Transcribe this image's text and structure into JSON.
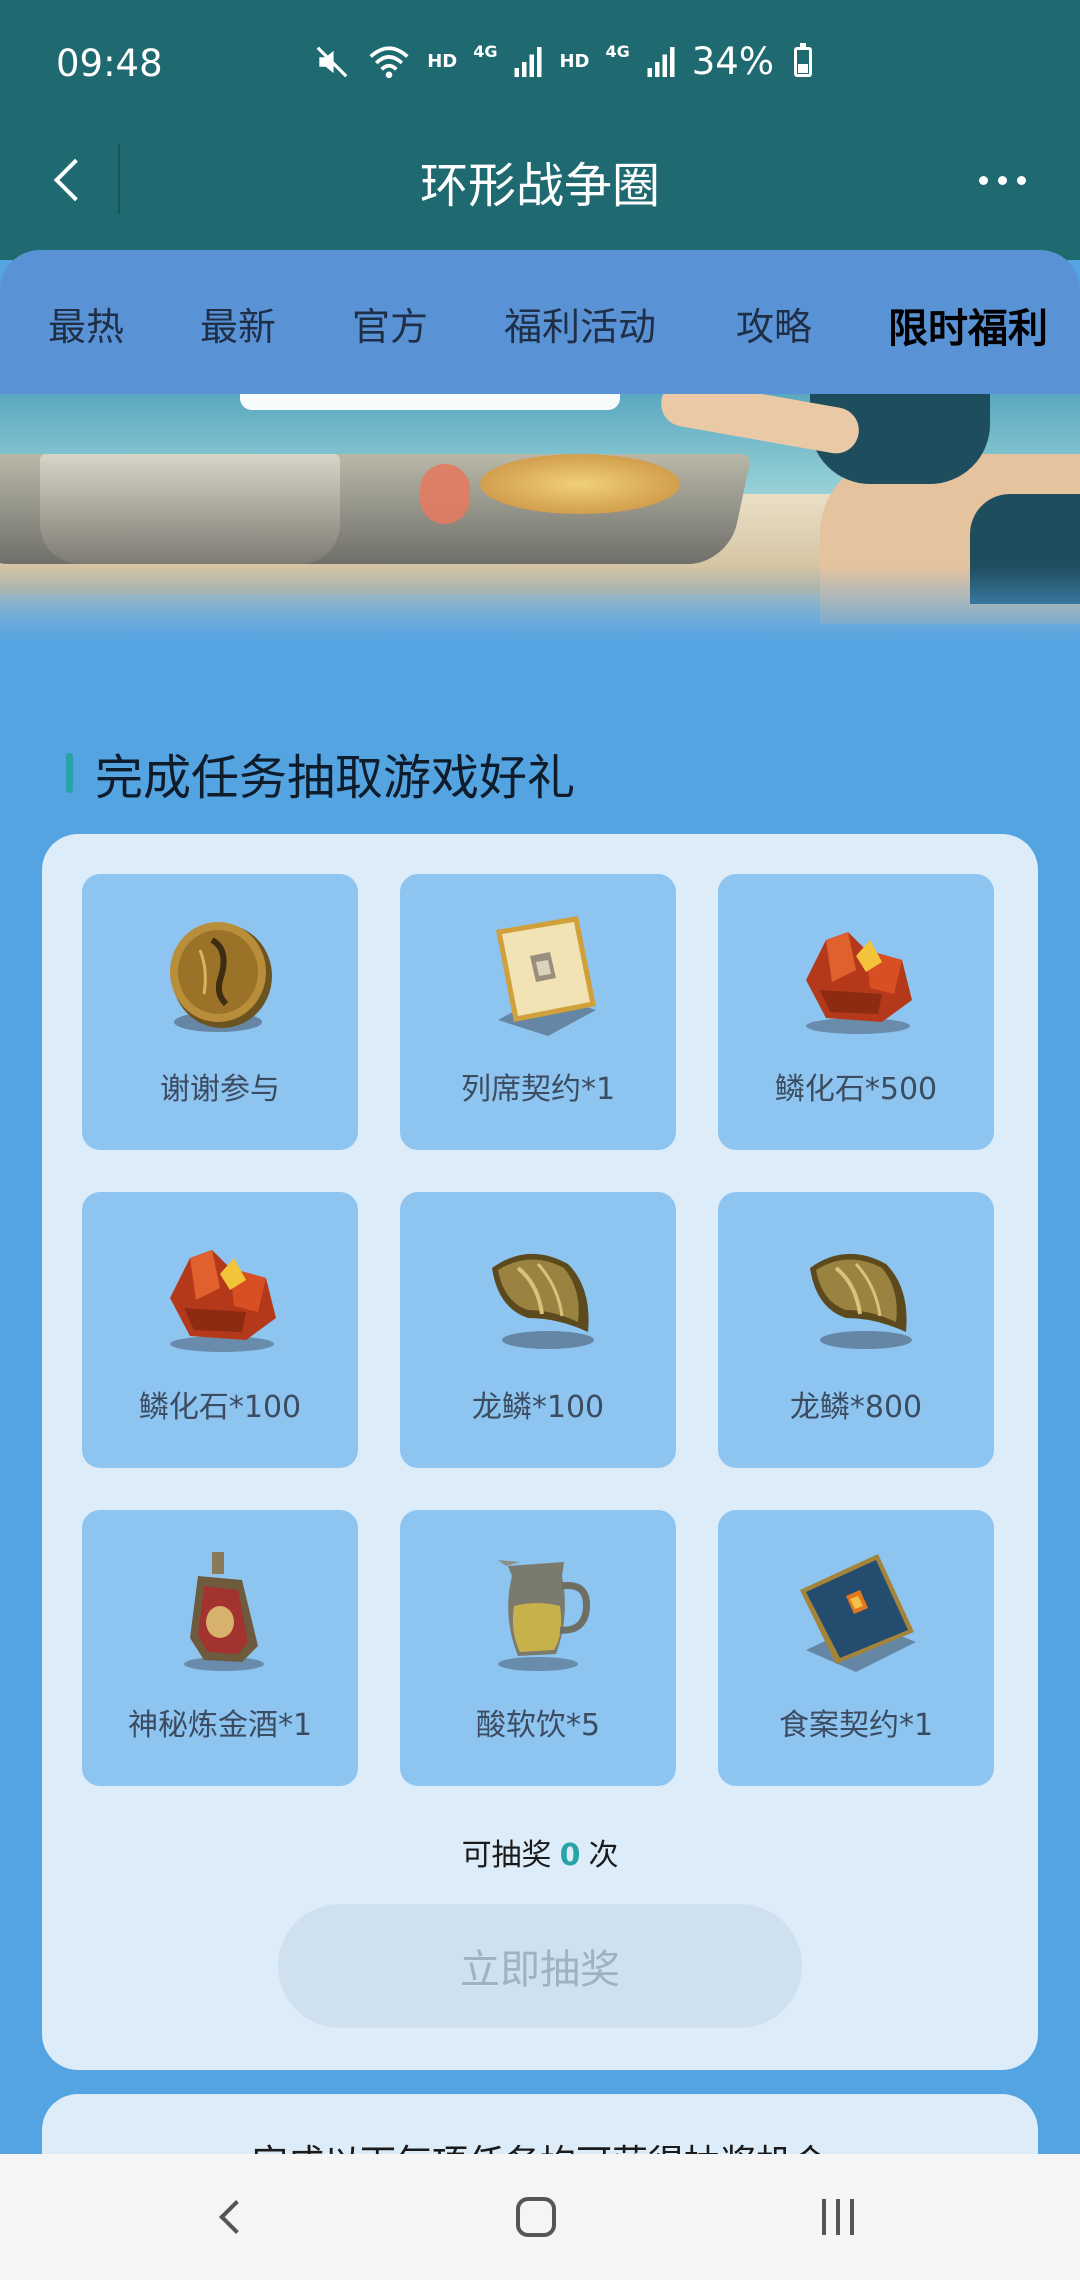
{
  "status_bar": {
    "time": "09:48",
    "hd1": "HD",
    "net1": "4G",
    "hd2": "HD",
    "net2": "4G",
    "battery": "34%",
    "icons": [
      "mute-icon",
      "wifi-icon",
      "signal-icon",
      "signal-icon",
      "battery-icon"
    ]
  },
  "app_bar": {
    "title": "环形战争圈",
    "back_icon": "back-icon",
    "more_icon": "more-icon"
  },
  "tabs": [
    {
      "label": "最热"
    },
    {
      "label": "最新"
    },
    {
      "label": "官方"
    },
    {
      "label": "福利活动"
    },
    {
      "label": "攻略"
    },
    {
      "label": "限时福利",
      "active": true
    }
  ],
  "section": {
    "title": "完成任务抽取游戏好礼"
  },
  "prizes": [
    {
      "name": "谢谢参与",
      "icon": "coin-icon"
    },
    {
      "name": "列席契约*1",
      "icon": "contract-card-icon"
    },
    {
      "name": "鳞化石*500",
      "icon": "scale-fossil-icon"
    },
    {
      "name": "鳞化石*100",
      "icon": "scale-fossil-icon"
    },
    {
      "name": "龙鳞*100",
      "icon": "dragon-scale-icon"
    },
    {
      "name": "龙鳞*800",
      "icon": "dragon-scale-icon"
    },
    {
      "name": "神秘炼金酒*1",
      "icon": "alchemy-bottle-icon"
    },
    {
      "name": "酸软饮*5",
      "icon": "pitcher-icon"
    },
    {
      "name": "食案契约*1",
      "icon": "blue-card-icon"
    }
  ],
  "draw": {
    "prefix": "可抽奖",
    "count": "0",
    "suffix": "次",
    "button_label": "立即抽奖"
  },
  "tasks_card": {
    "text": "完成以下每项任务均可获得抽奖机会"
  },
  "colors": {
    "top_bar": "#1f6a70",
    "page_bg": "#54a4e1",
    "tabs_bg": "#5a93d5",
    "card_bg": "#ddecf9",
    "prize_bg": "#8ec4f0",
    "accent": "#2aa3a7"
  }
}
